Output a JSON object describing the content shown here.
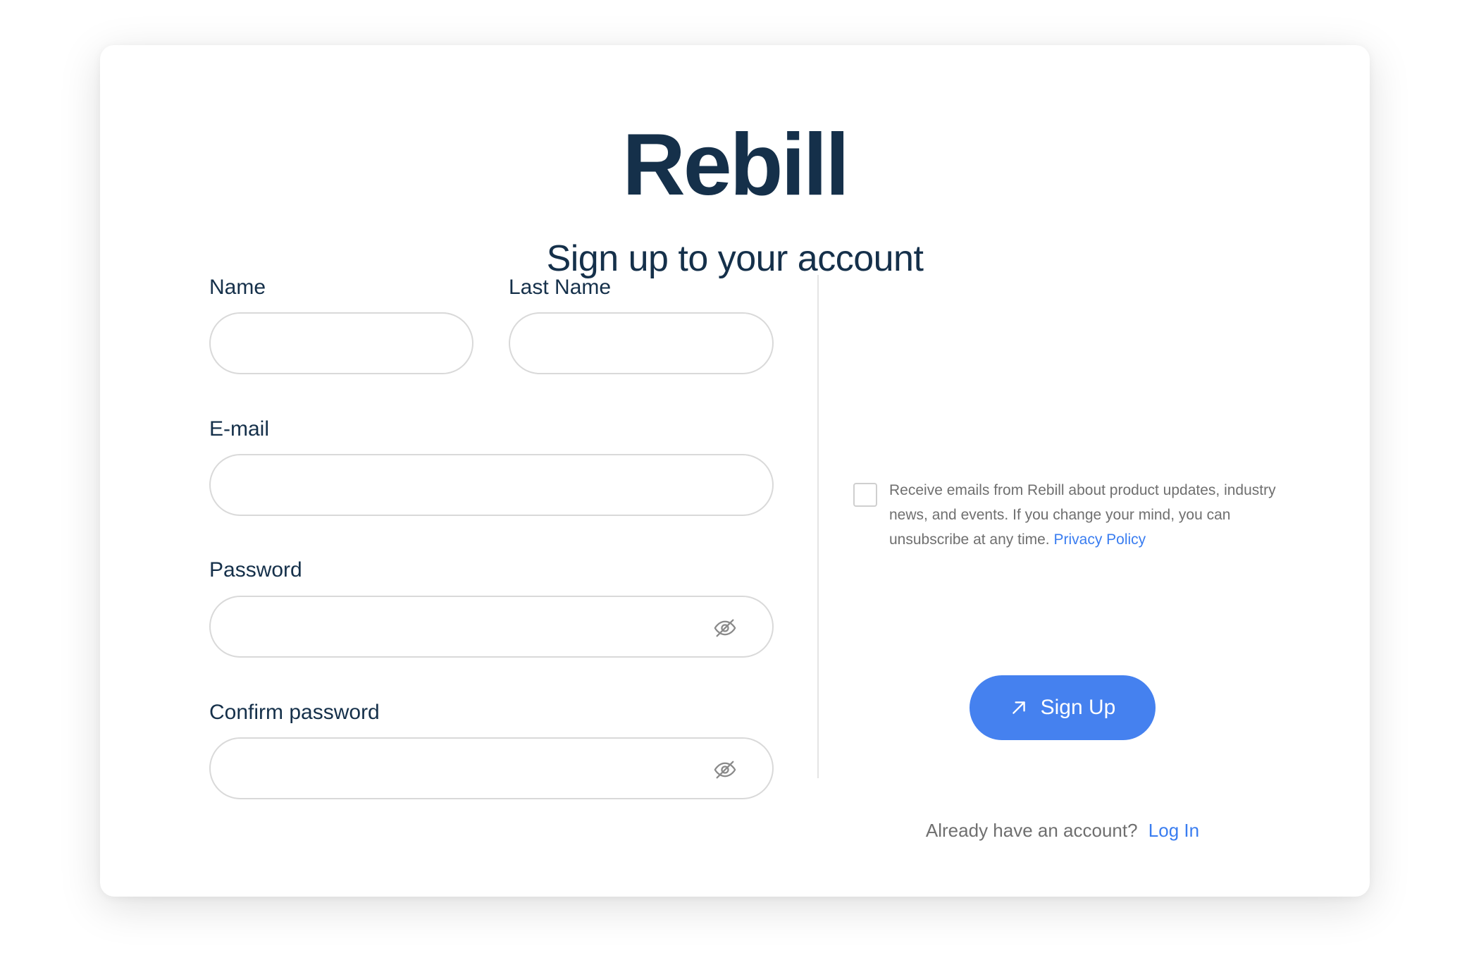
{
  "brand": {
    "logo_text": "Rebill",
    "primary_color": "#4581ef",
    "text_color": "#15304a",
    "link_color": "#3a7df0"
  },
  "heading": "Sign up to your account",
  "form": {
    "name": {
      "label": "Name",
      "value": "",
      "placeholder": ""
    },
    "last_name": {
      "label": "Last Name",
      "value": "",
      "placeholder": ""
    },
    "email": {
      "label": "E-mail",
      "value": "",
      "placeholder": ""
    },
    "password": {
      "label": "Password",
      "value": "",
      "placeholder": "",
      "toggle_icon": "eye-off-icon"
    },
    "confirm_password": {
      "label": "Confirm password",
      "value": "",
      "placeholder": "",
      "toggle_icon": "eye-off-icon"
    }
  },
  "consent": {
    "checked": false,
    "text": "Receive emails from Rebill about product updates, industry news, and events. If you change your mind, you can unsubscribe at any time.",
    "privacy_link": "Privacy Policy"
  },
  "signup_button": {
    "label": "Sign Up",
    "icon": "arrow-up-right-icon"
  },
  "login_prompt": {
    "text": "Already have an account?",
    "link": "Log In"
  }
}
